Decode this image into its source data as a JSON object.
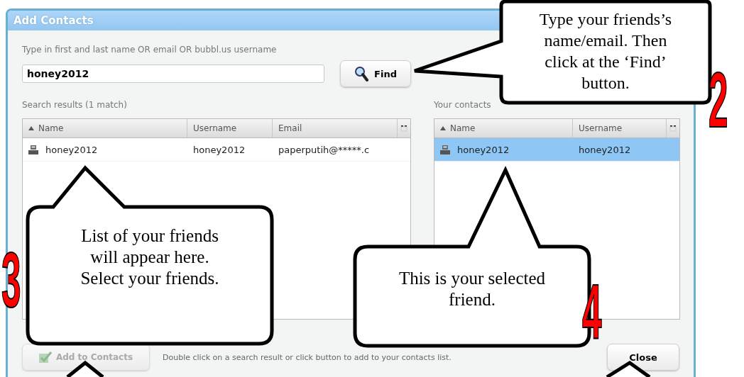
{
  "window": {
    "title": "Add Contacts"
  },
  "search": {
    "label": "Type in first and last name OR email OR bubbl.us username",
    "value": "honey2012",
    "button": "Find"
  },
  "results": {
    "label": "Search results (1 match)",
    "columns": [
      {
        "label": "Name",
        "sorted": true
      },
      {
        "label": "Username",
        "sorted": false
      },
      {
        "label": "Email",
        "sorted": false
      }
    ],
    "rows": [
      {
        "cells": [
          "honey2012",
          "honey2012",
          "paperputih@*****.c"
        ],
        "selected": false
      }
    ]
  },
  "contacts": {
    "label": "Your contacts",
    "columns": [
      {
        "label": "Name",
        "sorted": true
      },
      {
        "label": "Username",
        "sorted": false
      }
    ],
    "rows": [
      {
        "cells": [
          "honey2012",
          "honey2012"
        ],
        "selected": true
      }
    ]
  },
  "footer": {
    "add_button": {
      "label": "Add to Contacts",
      "disabled": true
    },
    "hint": "Double click on a search result or click button to add to your contacts list.",
    "close_button": "Close"
  },
  "callouts": [
    {
      "lines": [
        "Type your friends’s",
        "name/email. Then",
        "click at the ‘Find’",
        "button."
      ],
      "number": "2"
    },
    {
      "lines": [
        "List of your friends",
        "will appear here.",
        "Select your friends."
      ],
      "number": "3"
    },
    {
      "lines": [
        "This is your selected",
        "friend."
      ],
      "number": "4"
    }
  ]
}
